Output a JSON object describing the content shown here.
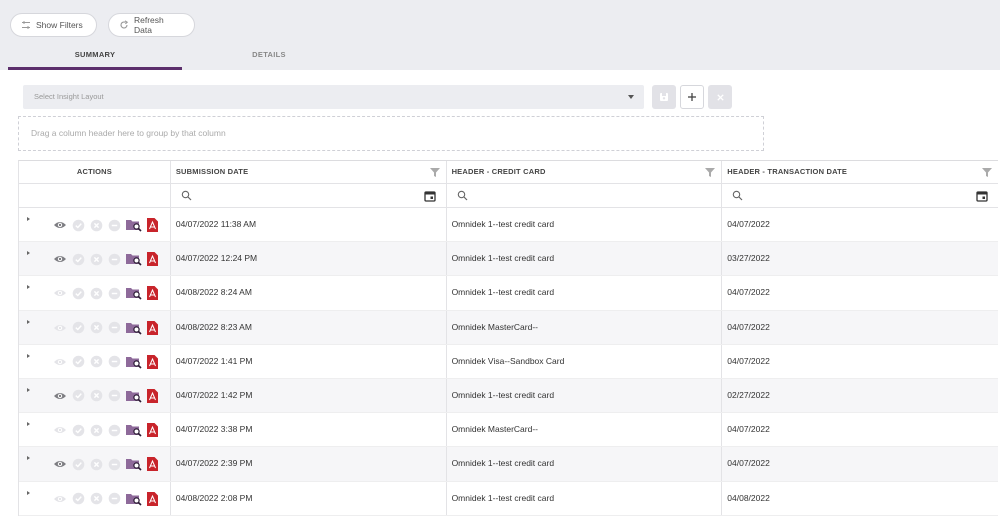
{
  "toolbar": {
    "show_filters": "Show Filters",
    "refresh_data": "Refresh Data"
  },
  "tabs": [
    {
      "label": "SUMMARY",
      "active": true
    },
    {
      "label": "DETAILS",
      "active": false
    }
  ],
  "layout_select": {
    "placeholder": "Select Insight Layout"
  },
  "group_area": {
    "hint": "Drag a column header here to group by that column"
  },
  "grid": {
    "columns": [
      "ACTIONS",
      "SUBMISSION DATE",
      "HEADER - CREDIT CARD",
      "HEADER - TRANSACTION DATE"
    ],
    "rows": [
      {
        "submission_date": "04/07/2022 11:38 AM",
        "credit_card": "Omnidek 1--test credit card",
        "transaction_date": "04/07/2022",
        "view_active": true
      },
      {
        "submission_date": "04/07/2022 12:24 PM",
        "credit_card": "Omnidek 1--test credit card",
        "transaction_date": "03/27/2022",
        "view_active": true
      },
      {
        "submission_date": "04/08/2022 8:24 AM",
        "credit_card": "Omnidek 1--test credit card",
        "transaction_date": "04/07/2022",
        "view_active": false
      },
      {
        "submission_date": "04/08/2022 8:23 AM",
        "credit_card": "Omnidek MasterCard--",
        "transaction_date": "04/07/2022",
        "view_active": false
      },
      {
        "submission_date": "04/07/2022 1:41 PM",
        "credit_card": "Omnidek Visa--Sandbox Card",
        "transaction_date": "04/07/2022",
        "view_active": false
      },
      {
        "submission_date": "04/07/2022 1:42 PM",
        "credit_card": "Omnidek 1--test credit card",
        "transaction_date": "02/27/2022",
        "view_active": true
      },
      {
        "submission_date": "04/07/2022 3:38 PM",
        "credit_card": "Omnidek MasterCard--",
        "transaction_date": "04/07/2022",
        "view_active": false
      },
      {
        "submission_date": "04/07/2022 2:39 PM",
        "credit_card": "Omnidek 1--test credit card",
        "transaction_date": "04/07/2022",
        "view_active": true
      },
      {
        "submission_date": "04/08/2022 2:08 PM",
        "credit_card": "Omnidek 1--test credit card",
        "transaction_date": "04/08/2022",
        "view_active": false
      }
    ]
  },
  "colors": {
    "accent": "#5c2f6c",
    "pdf_red": "#c8242b",
    "folder": "#8e6a9a",
    "topbar": "#ecedf1"
  }
}
